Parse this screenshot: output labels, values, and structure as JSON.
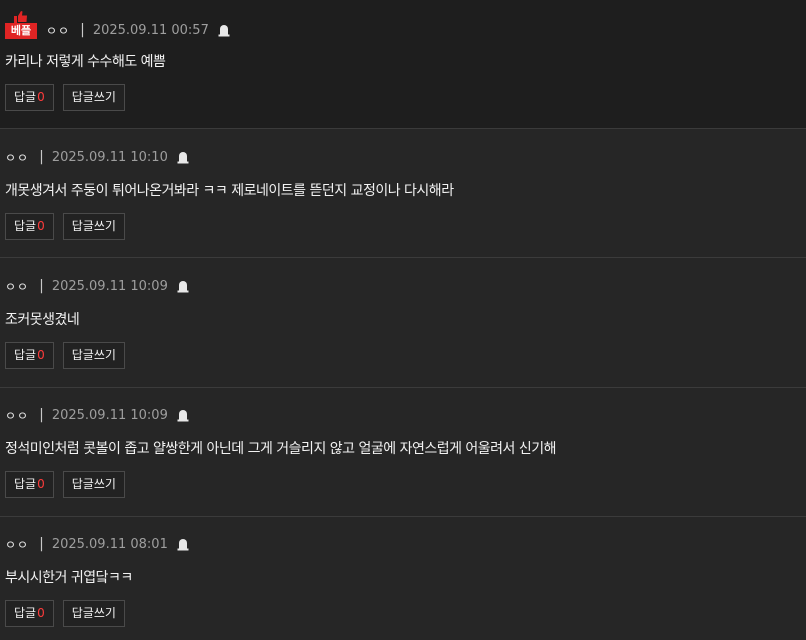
{
  "comments": [
    {
      "best_badge": "베플",
      "author": "ㅇㅇ",
      "separator": "|",
      "date": "2025.09.11 00:57",
      "text": "카리나 저렇게 수수해도 예쁨",
      "reply_label": "답글",
      "reply_count": "0",
      "write_reply_label": "답글쓰기"
    },
    {
      "author": "ㅇㅇ",
      "separator": "|",
      "date": "2025.09.11 10:10",
      "text": "개못생겨서 주둥이 튀어나온거봐라 ㅋㅋ 제로네이트를 뜯던지 교정이나 다시해라",
      "reply_label": "답글",
      "reply_count": "0",
      "write_reply_label": "답글쓰기"
    },
    {
      "author": "ㅇㅇ",
      "separator": "|",
      "date": "2025.09.11 10:09",
      "text": "조커못생겼네",
      "reply_label": "답글",
      "reply_count": "0",
      "write_reply_label": "답글쓰기"
    },
    {
      "author": "ㅇㅇ",
      "separator": "|",
      "date": "2025.09.11 10:09",
      "text": "정석미인처럼 콧볼이 좁고 얄쌍한게 아닌데 그게 거슬리지 않고 얼굴에 자연스럽게 어울려서 신기해",
      "reply_label": "답글",
      "reply_count": "0",
      "write_reply_label": "답글쓰기"
    },
    {
      "author": "ㅇㅇ",
      "separator": "|",
      "date": "2025.09.11 08:01",
      "text": "부시시한거 귀엽닼ㅋㅋ",
      "reply_label": "답글",
      "reply_count": "0",
      "write_reply_label": "답글쓰기"
    }
  ],
  "colors": {
    "best_badge": "#e02424",
    "reply_count": "#ff3b3b",
    "background": "#262626"
  },
  "icons": {
    "best": "thumbs-up-icon",
    "report": "siren-icon"
  }
}
